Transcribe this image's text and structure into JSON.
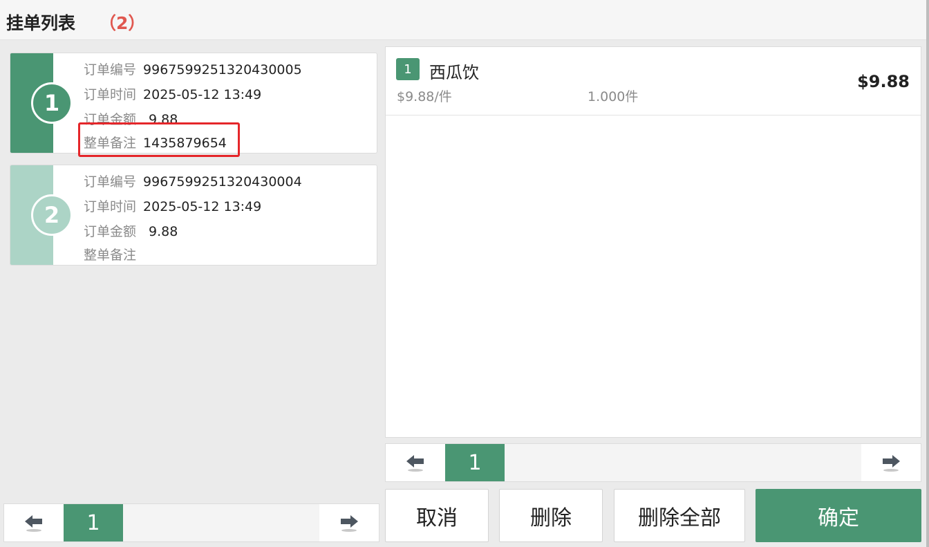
{
  "header": {
    "title": "挂单列表",
    "count": "（2）"
  },
  "orders": [
    {
      "index": "1",
      "order_no_label": "订单编号",
      "order_no": "9967599251320430005",
      "time_label": "订单时间",
      "time": "2025-05-12 13:49",
      "amount_label": "订单金额",
      "amount": "9.88",
      "note_label": "整单备注",
      "note": "1435879654"
    },
    {
      "index": "2",
      "order_no_label": "订单编号",
      "order_no": "9967599251320430004",
      "time_label": "订单时间",
      "time": "2025-05-12 13:49",
      "amount_label": "订单金额",
      "amount": "9.88",
      "note_label": "整单备注",
      "note": ""
    }
  ],
  "left_pager": {
    "page": "1"
  },
  "detail": {
    "items": [
      {
        "index": "1",
        "name": "西瓜饮",
        "unit_price": "$9.88/件",
        "quantity": "1.000件",
        "total": "$9.88"
      }
    ]
  },
  "right_pager": {
    "page": "1"
  },
  "buttons": {
    "cancel": "取消",
    "delete": "删除",
    "delete_all": "删除全部",
    "confirm": "确定"
  },
  "colors": {
    "accent": "#4a9673",
    "accent_light": "#acd4c6",
    "highlight": "#e5262a",
    "count": "#e0574f"
  },
  "icons": {
    "prev": "arrow-left-icon",
    "next": "arrow-right-icon"
  }
}
